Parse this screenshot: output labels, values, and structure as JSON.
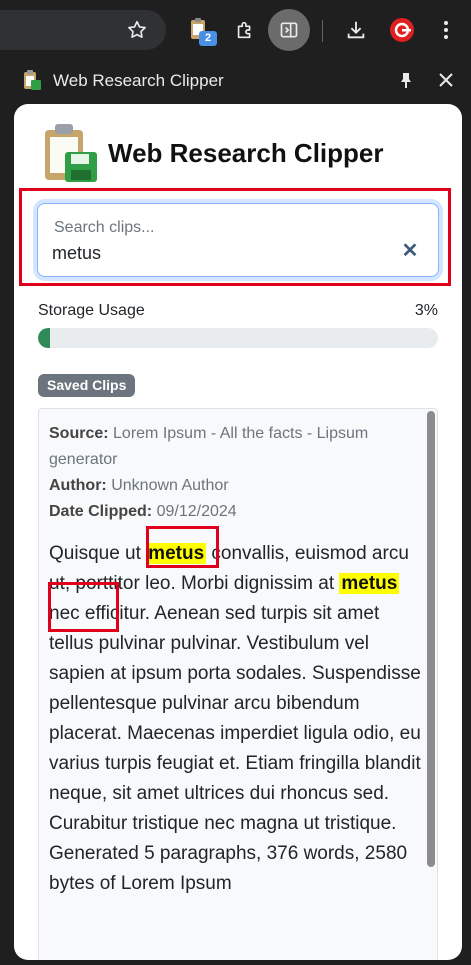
{
  "browser": {
    "extension_badge": "2"
  },
  "panel": {
    "title": "Web Research Clipper"
  },
  "app": {
    "title": "Web Research Clipper",
    "search": {
      "placeholder": "Search clips...",
      "value": "metus"
    },
    "storage": {
      "label": "Storage Usage",
      "percent_text": "3%",
      "percent": 3
    },
    "saved_clips_label": "Saved Clips",
    "clip": {
      "source_label": "Source:",
      "source": "Lorem Ipsum - All the facts - Lipsum generator",
      "author_label": "Author:",
      "author": "Unknown Author",
      "date_label": "Date Clipped:",
      "date": "09/12/2024",
      "text_1": "Quisque ut ",
      "match_1": "metus",
      "text_2": " convallis, euismod arcu ut, porttitor leo. Morbi dignissim at ",
      "match_2": "metus",
      "text_3": " nec efficitur. Aenean sed turpis sit amet tellus pulvinar pulvinar. Vestibulum vel sapien at ipsum porta sodales. Suspendisse pellentesque pulvinar arcu bibendum placerat. Maecenas imperdiet ligula odio, eu varius turpis feugiat et. Etiam fringilla blandit neque, sit amet ultrices dui rhoncus sed. Curabitur tristique nec magna ut tristique. Generated 5 paragraphs, 376 words, 2580 bytes of Lorem Ipsum"
    }
  },
  "colors": {
    "highlight_box": "#e0001b",
    "match_highlight": "#ffff00",
    "progress": "#2e8b57"
  }
}
